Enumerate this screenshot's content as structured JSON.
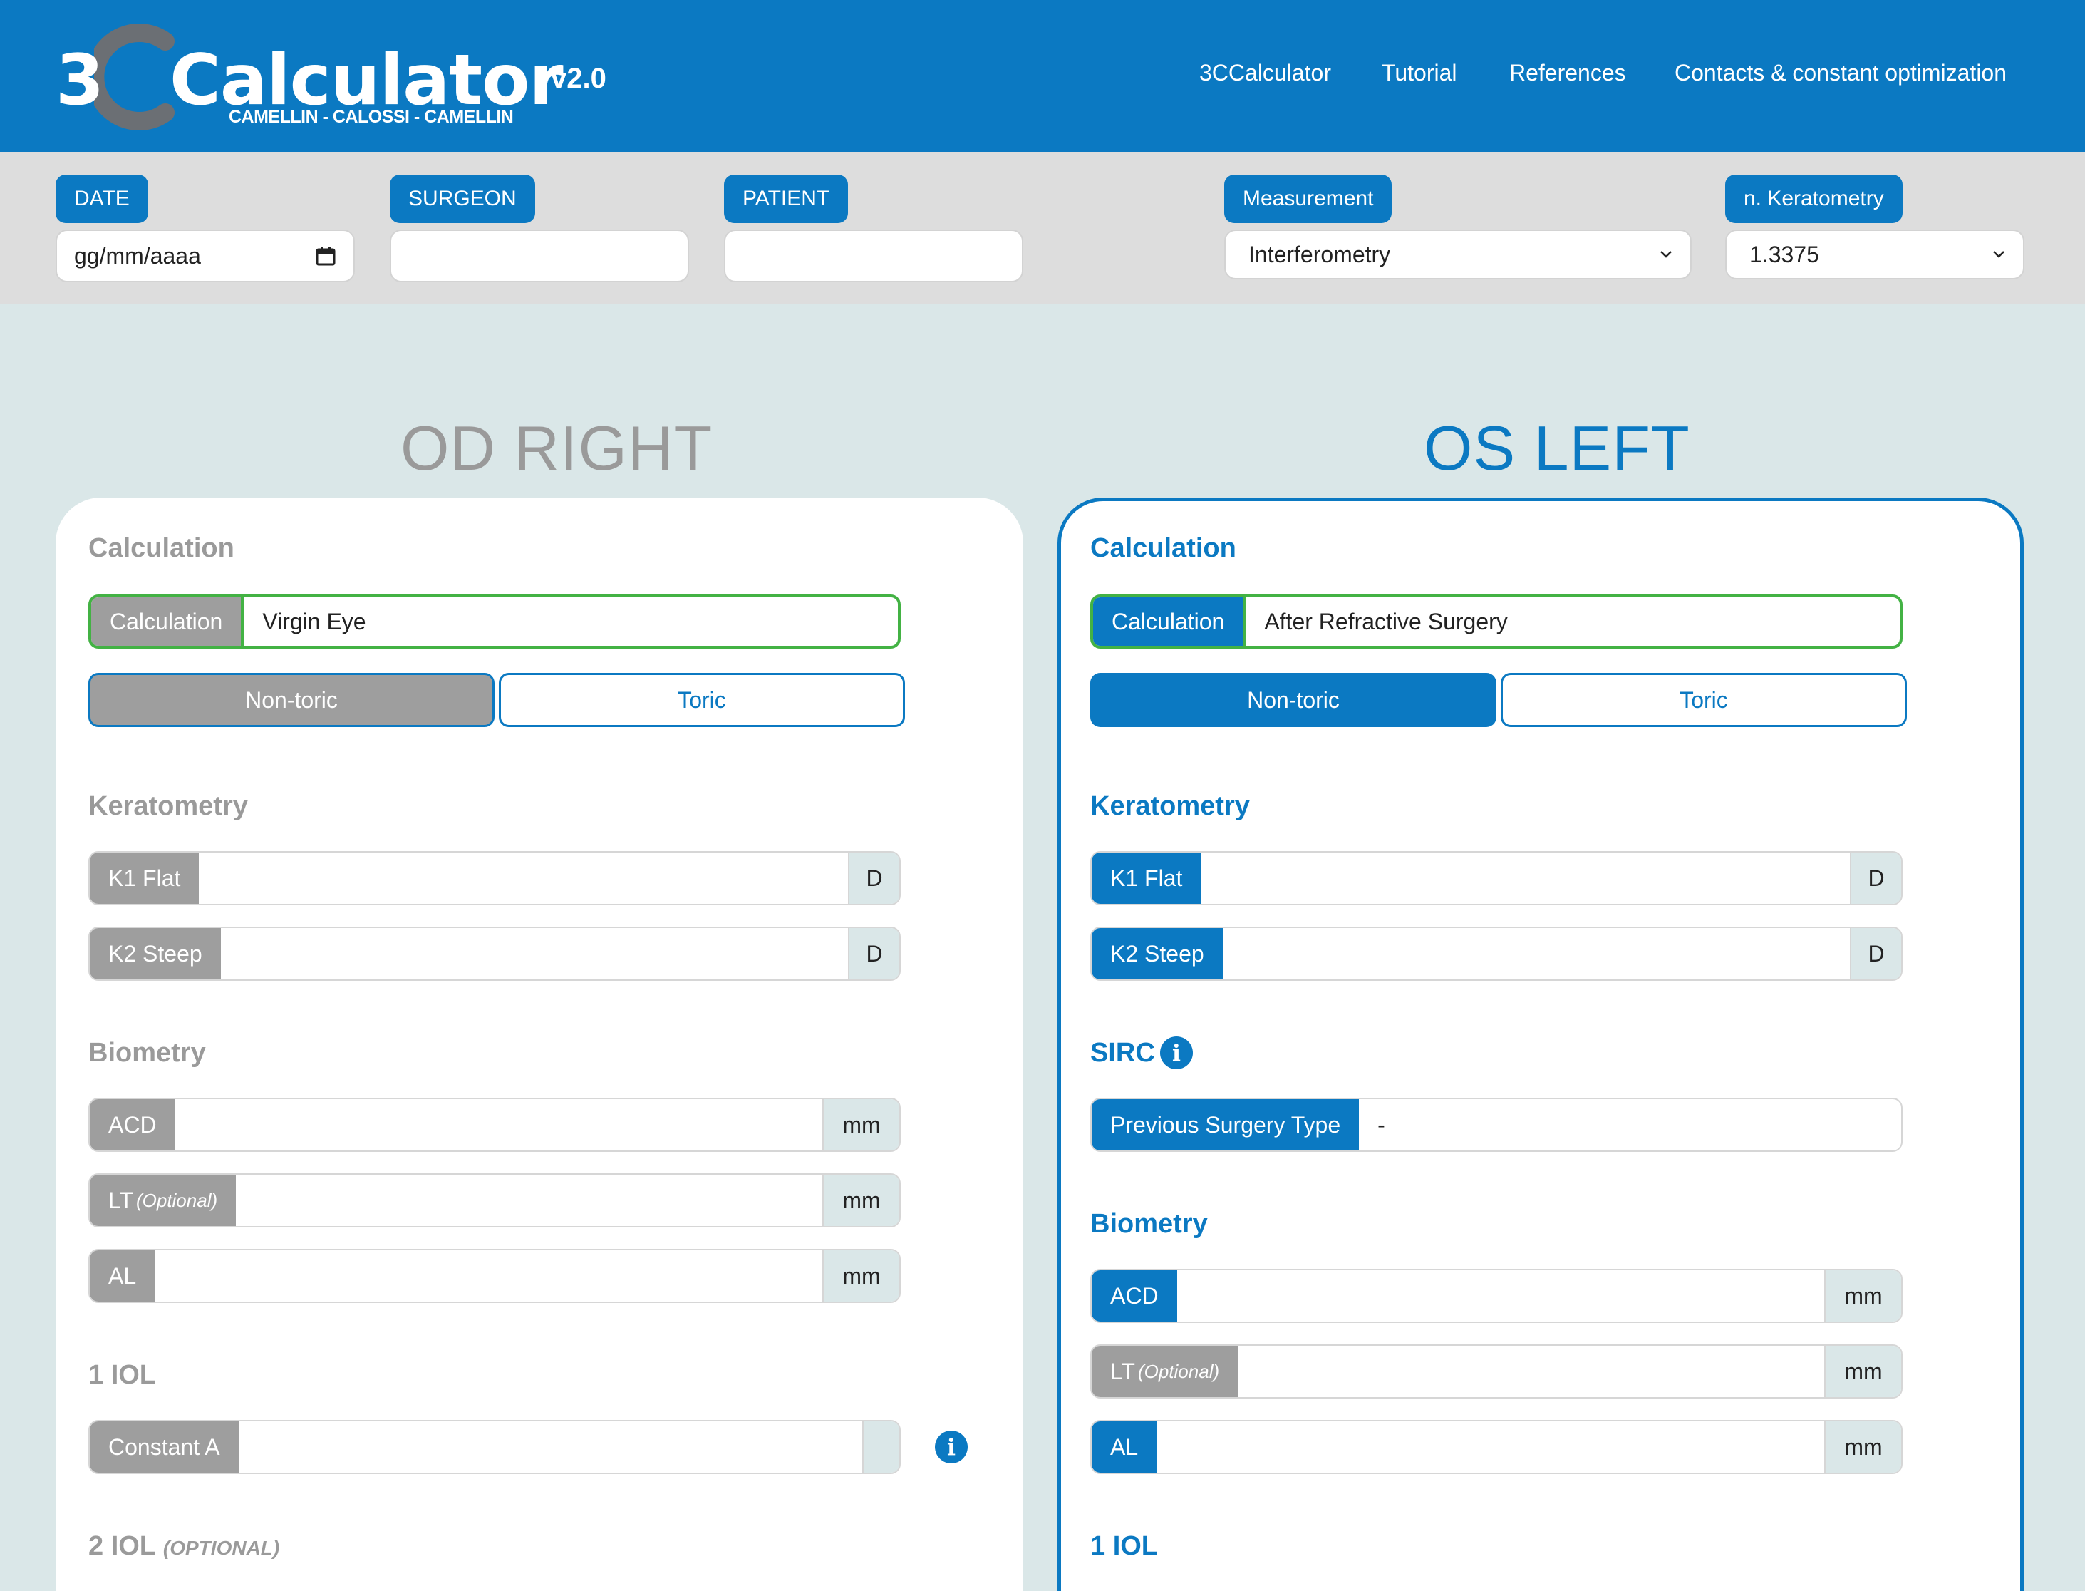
{
  "header": {
    "logo_three": "3",
    "logo_word": "Calculator",
    "logo_subtitle": "CAMELLIN - CALOSSI - CAMELLIN",
    "version": "v2.0",
    "nav": [
      "3CCalculator",
      "Tutorial",
      "References",
      "Contacts & constant optimization"
    ],
    "colors": {
      "primary": "#0b79c2",
      "accent_ring": "#6b6f74"
    }
  },
  "top_form": {
    "date_label": "DATE",
    "date_value": "gg/mm/aaaa",
    "surgeon_label": "SURGEON",
    "surgeon_value": "",
    "patient_label": "PATIENT",
    "patient_value": "",
    "measurement_label": "Measurement",
    "measurement_value": "Interferometry",
    "keratometry_label": "n. Keratometry",
    "keratometry_value": "1.3375"
  },
  "right_eye": {
    "title": "OD RIGHT",
    "calculation_section": "Calculation",
    "calculation_label": "Calculation",
    "calculation_value": "Virgin Eye",
    "nontoric": "Non-toric",
    "toric": "Toric",
    "keratometry_section": "Keratometry",
    "k1_label": "K1 Flat",
    "k2_label": "K2 Steep",
    "k_unit": "D",
    "biometry_section": "Biometry",
    "acd_label": "ACD",
    "lt_label": "LT",
    "lt_optional": "(Optional)",
    "al_label": "AL",
    "mm_unit": "mm",
    "iol1_section": "1 IOL",
    "constant_label": "Constant A",
    "iol2_section": "2 IOL",
    "iol2_optional": "(OPTIONAL)"
  },
  "left_eye": {
    "title": "OS LEFT",
    "calculation_section": "Calculation",
    "calculation_label": "Calculation",
    "calculation_value": "After Refractive Surgery",
    "nontoric": "Non-toric",
    "toric": "Toric",
    "keratometry_section": "Keratometry",
    "k1_label": "K1 Flat",
    "k2_label": "K2 Steep",
    "k_unit": "D",
    "sirc_section": "SIRC",
    "prev_surgery_label": "Previous Surgery Type",
    "prev_surgery_value": "-",
    "biometry_section": "Biometry",
    "acd_label": "ACD",
    "lt_label": "LT",
    "lt_optional": "(Optional)",
    "al_label": "AL",
    "mm_unit": "mm",
    "iol1_section": "1 IOL"
  }
}
